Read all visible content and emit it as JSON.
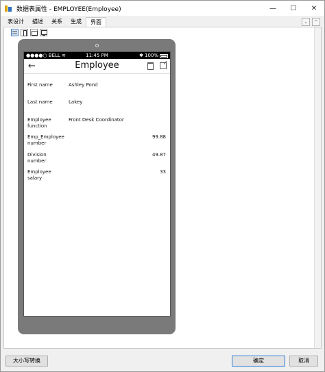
{
  "window": {
    "title": "数据表属性 - EMPLOYEE(Employee)",
    "controls": {
      "minimize": "—",
      "maximize": "☐",
      "close": "✕"
    }
  },
  "tabs": [
    {
      "label": "表设计"
    },
    {
      "label": "描述"
    },
    {
      "label": "关系"
    },
    {
      "label": "生成"
    },
    {
      "label": "界面",
      "active": true
    }
  ],
  "tab_arrows": {
    "down": "⌄",
    "up": "⌃"
  },
  "toolbar": [
    "sliders-icon",
    "phone-icon",
    "tablet-icon",
    "monitor-icon"
  ],
  "phone": {
    "status": {
      "carrier": "●●●●○ BELL",
      "wifi": "≋",
      "time": "11:45 PM",
      "bluetooth": "✱",
      "battery": "100%"
    },
    "nav": {
      "back": "←",
      "title": "Employee"
    },
    "fields": [
      {
        "label": "First name",
        "value": "Ashley Pond"
      },
      {
        "label": "Last name",
        "value": "Lakey"
      },
      {
        "label": "Employee function",
        "value": "Front Desk Coordinator"
      },
      {
        "label": "Emp_Employee number",
        "value": "99.88",
        "numeric": true
      },
      {
        "label": "Division number",
        "value": "49.87",
        "numeric": true
      },
      {
        "label": "Employee salary",
        "value": "33",
        "numeric": true
      }
    ]
  },
  "buttons": {
    "case_convert": "大小写转换",
    "ok": "确定",
    "cancel": "取消"
  }
}
